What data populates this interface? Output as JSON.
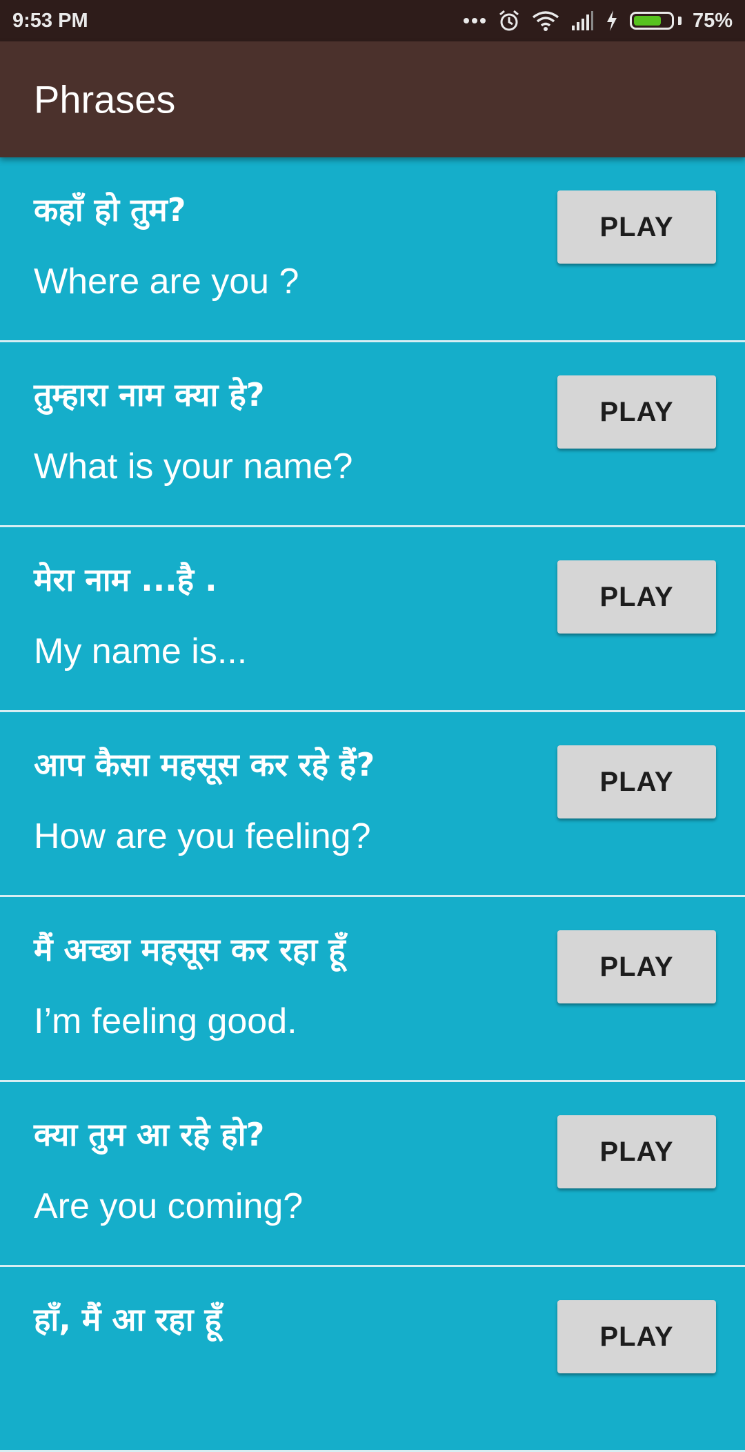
{
  "status_bar": {
    "time": "9:53 PM",
    "icons": [
      "more-dots-icon",
      "alarm-icon",
      "wifi-icon",
      "signal-icon",
      "charging-bolt-icon",
      "battery-icon"
    ],
    "battery_percent": "75%",
    "battery_level": 0.75,
    "battery_color": "#57c21f"
  },
  "app_bar": {
    "title": "Phrases",
    "color": "#4b312c"
  },
  "colors": {
    "list_background": "#15aeca",
    "divider": "#d7eef3",
    "button": "#d6d6d6"
  },
  "phrases": [
    {
      "hindi": " कहाँ हो तुम?",
      "english": "Where are you ?",
      "button": "PLAY"
    },
    {
      "hindi": "तुम्हारा नाम क्या हे?",
      "english": "What is your name?",
      "button": "PLAY"
    },
    {
      "hindi": "मेरा नाम ...है .",
      "english": "My name is...",
      "button": "PLAY"
    },
    {
      "hindi": "आप कैसा महसूस कर रहे हैं?",
      "english": "How are you feeling?",
      "button": "PLAY"
    },
    {
      "hindi": "मैं अच्छा महसूस कर रहा हूँ",
      "english": "I’m feeling good.",
      "button": "PLAY"
    },
    {
      "hindi": "क्या तुम आ रहे हो?",
      "english": "Are you coming?",
      "button": "PLAY"
    },
    {
      "hindi": "हाँ, मैं आ रहा हूँ",
      "english": "",
      "button": "PLAY"
    }
  ]
}
